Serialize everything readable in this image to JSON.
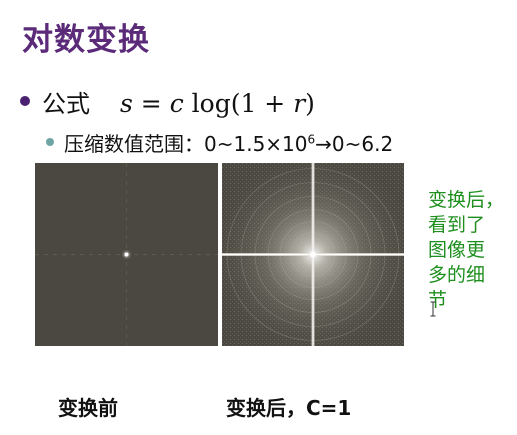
{
  "slide": {
    "title": "对数变换",
    "bullet1": {
      "label": "公式",
      "formula": "s = c log(1 + r)"
    },
    "bullet2": {
      "prefix": "压缩数值范围：0~1.5×10",
      "sup": "6",
      "suffix": "→0~6.2"
    },
    "side_note": "变换后，\n看到了\n图像更\n多的细\n节",
    "captions": {
      "before": "变换前",
      "after": "变换后，C=1"
    },
    "colors": {
      "title": "#5b2b7a",
      "note": "#1f8f1f",
      "image_bg": "#4a4840"
    }
  }
}
